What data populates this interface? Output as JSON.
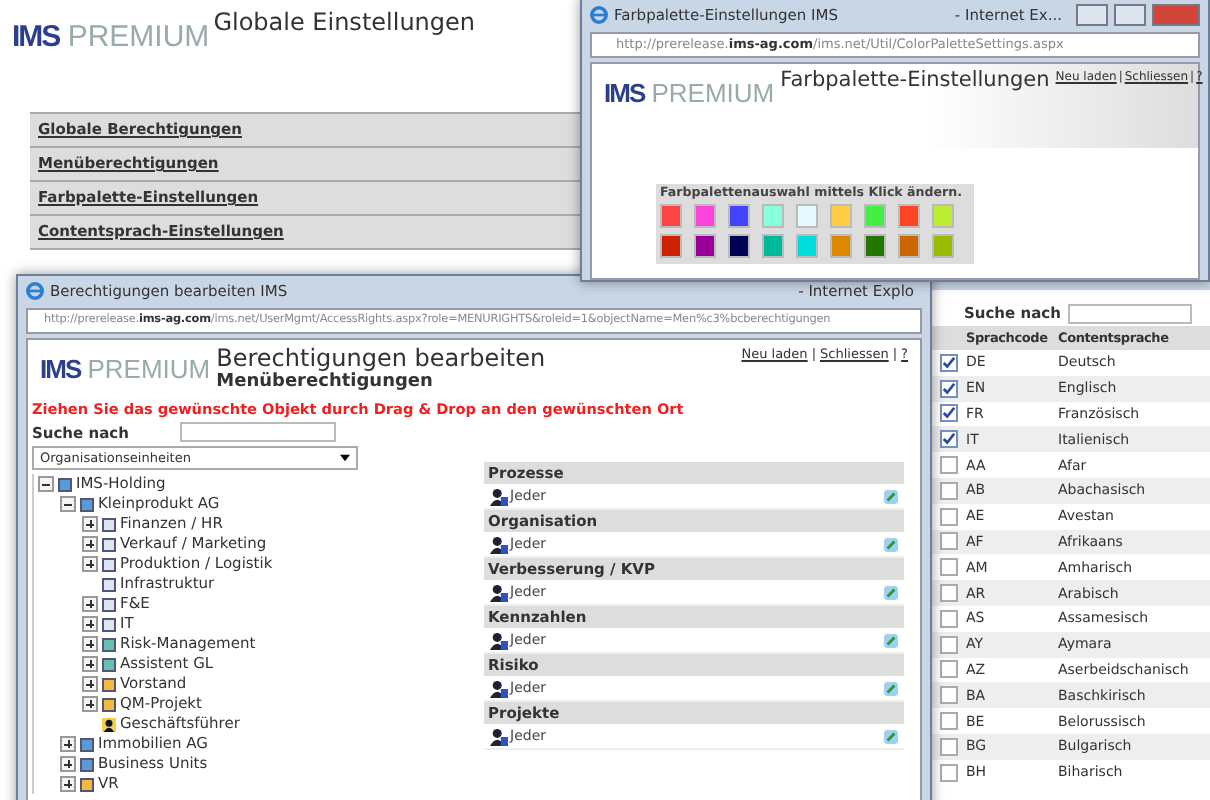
{
  "main_page": {
    "logo": {
      "brand": "IMS",
      "product": "PREMIUM"
    },
    "title": "Globale Einstellungen",
    "menu": [
      "Globale Berechtigungen",
      "Menüberechtigungen",
      "Farbpalette-Einstellungen",
      "Contentsprach-Einstellungen"
    ]
  },
  "palette_window": {
    "title": "Farbpalette-Einstellungen IMS",
    "browser": "- Internet Ex...",
    "url": "http://prerelease.**ims-ag.com**/ims.net/Util/ColorPaletteSettings.aspx",
    "logo": {
      "brand": "IMS",
      "product": "PREMIUM"
    },
    "heading": "Farbpalette-Einstellungen",
    "links": [
      {
        "kind": "link",
        "text": "Neu laden"
      },
      {
        "kind": "separator",
        "text": "|"
      },
      {
        "kind": "link",
        "text": "Schliessen"
      },
      {
        "kind": "separator",
        "text": "|"
      },
      {
        "kind": "link",
        "text": "?"
      }
    ],
    "palette_label": "Farbpalettenauswahl mittels Klick ändern.",
    "swatches": [
      {
        "color": "#ff4444"
      },
      {
        "color": "#ff44dd"
      },
      {
        "color": "#4444ff"
      },
      {
        "color": "#88ffdd"
      },
      {
        "color": "#e8f8ff"
      },
      {
        "color": "#ffcc44"
      },
      {
        "color": "#44ee44"
      },
      {
        "color": "#ff4422"
      },
      {
        "color": "#bbee33"
      },
      {
        "color": "#cc2200"
      },
      {
        "color": "#990099"
      },
      {
        "color": "#000055"
      },
      {
        "color": "#00bb99"
      },
      {
        "color": "#00dddd"
      },
      {
        "color": "#dd8800"
      },
      {
        "color": "#227700"
      },
      {
        "color": "#cc6600"
      },
      {
        "color": "#99bb00"
      }
    ]
  },
  "rights_window": {
    "title": "Berechtigungen bearbeiten IMS",
    "browser": "- Internet Explo",
    "url": "http://prerelease.**ims-ag.com**/ims.net/UserMgmt/AccessRights.aspx?role=MENURIGHTS&roleid=1&objectName=Men%c3%bcberechtigungen",
    "logo": {
      "brand": "IMS",
      "product": "PREMIUM"
    },
    "heading": "Berechtigungen bearbeiten",
    "subheading": "Menüberechtigungen",
    "links": [
      {
        "kind": "link",
        "text": "Neu laden"
      },
      {
        "kind": "separator",
        "text": "|"
      },
      {
        "kind": "link",
        "text": "Schliessen"
      },
      {
        "kind": "separator",
        "text": "|"
      },
      {
        "kind": "link",
        "text": "?"
      }
    ],
    "hint": "Ziehen Sie das gewünschte Objekt durch Drag & Drop an den gewünschten Ort",
    "search_label": "Suche nach",
    "dropdown": "Organisationseinheiten",
    "tree": [
      {
        "label": "IMS-Holding",
        "kind": "expanded",
        "color": "#5b9bd5",
        "children": [
          {
            "label": "Kleinprodukt AG",
            "kind": "expanded",
            "color": "#5b9bd5",
            "children": [
              {
                "label": "Finanzen / HR",
                "kind": "collapsed",
                "color": "#dce6f2"
              },
              {
                "label": "Verkauf / Marketing",
                "kind": "collapsed",
                "color": "#dce6f2"
              },
              {
                "label": "Produktion / Logistik",
                "kind": "collapsed",
                "color": "#dce6f2"
              },
              {
                "label": "Infrastruktur",
                "kind": "leaf",
                "color": "#dce6f2"
              },
              {
                "label": "F&E",
                "kind": "collapsed",
                "color": "#dce6f2"
              },
              {
                "label": "IT",
                "kind": "collapsed",
                "color": "#dce6f2"
              },
              {
                "label": "Risk-Management",
                "kind": "collapsed",
                "color": "#66c2b0"
              },
              {
                "label": "Assistent GL",
                "kind": "collapsed",
                "color": "#66c2b0"
              },
              {
                "label": "Vorstand",
                "kind": "collapsed",
                "color": "#f5b942"
              },
              {
                "label": "QM-Projekt",
                "kind": "collapsed",
                "color": "#f5b942"
              },
              {
                "label": "Geschäftsführer",
                "kind": "person"
              }
            ]
          },
          {
            "label": "Immobilien AG",
            "kind": "collapsed",
            "color": "#5b9bd5"
          },
          {
            "label": "Business Units",
            "kind": "collapsed",
            "color": "#5b9bd5"
          },
          {
            "label": "VR",
            "kind": "collapsed",
            "color": "#f5b942"
          }
        ]
      }
    ],
    "sections": [
      {
        "title": "Prozesse",
        "entry": "Jeder"
      },
      {
        "title": "Organisation",
        "entry": "Jeder"
      },
      {
        "title": "Verbesserung / KVP",
        "entry": "Jeder"
      },
      {
        "title": "Kennzahlen",
        "entry": "Jeder"
      },
      {
        "title": "Risiko",
        "entry": "Jeder"
      },
      {
        "title": "Projekte",
        "entry": "Jeder"
      }
    ]
  },
  "language_window": {
    "search_label": "Suche nach",
    "columns": [
      "Sprachcode",
      "Contentsprache"
    ],
    "rows": [
      {
        "code": "DE",
        "name": "Deutsch",
        "checked": true
      },
      {
        "code": "EN",
        "name": "Englisch",
        "checked": true
      },
      {
        "code": "FR",
        "name": "Französisch",
        "checked": true
      },
      {
        "code": "IT",
        "name": "Italienisch",
        "checked": true
      },
      {
        "code": "AA",
        "name": "Afar",
        "checked": false
      },
      {
        "code": "AB",
        "name": "Abachasisch",
        "checked": false
      },
      {
        "code": "AE",
        "name": "Avestan",
        "checked": false
      },
      {
        "code": "AF",
        "name": "Afrikaans",
        "checked": false
      },
      {
        "code": "AM",
        "name": "Amharisch",
        "checked": false
      },
      {
        "code": "AR",
        "name": "Arabisch",
        "checked": false
      },
      {
        "code": "AS",
        "name": "Assamesisch",
        "checked": false
      },
      {
        "code": "AY",
        "name": "Aymara",
        "checked": false
      },
      {
        "code": "AZ",
        "name": "Aserbeidschanisch",
        "checked": false
      },
      {
        "code": "BA",
        "name": "Baschkirisch",
        "checked": false
      },
      {
        "code": "BE",
        "name": "Belorussisch",
        "checked": false
      },
      {
        "code": "BG",
        "name": "Bulgarisch",
        "checked": false
      },
      {
        "code": "BH",
        "name": "Biharisch",
        "checked": false
      }
    ]
  }
}
